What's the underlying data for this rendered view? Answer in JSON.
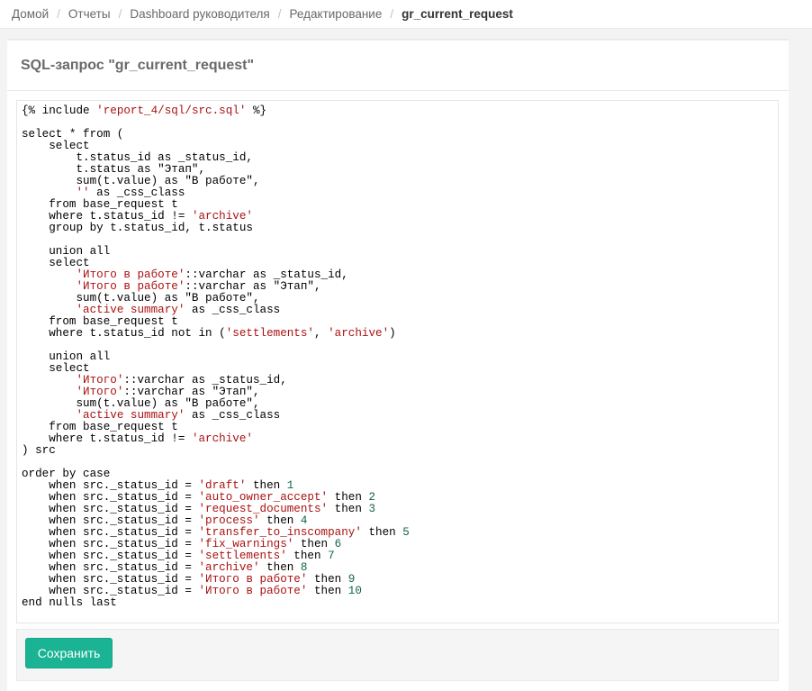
{
  "breadcrumb": {
    "items": [
      "Домой",
      "Отчеты",
      "Dashboard руководителя",
      "Редактирование"
    ],
    "current": "gr_current_request",
    "separator": "/"
  },
  "panel": {
    "title": "SQL-запрос \"gr_current_request\""
  },
  "editor": {
    "lines": [
      "{% include 'report_4/sql/src.sql' %}",
      "",
      "select * from (",
      "    select",
      "        t.status_id as _status_id,",
      "        t.status as \"Этап\",",
      "        sum(t.value) as \"В работе\",",
      "        '' as _css_class",
      "    from base_request t",
      "    where t.status_id != 'archive'",
      "    group by t.status_id, t.status",
      "",
      "    union all",
      "    select",
      "        'Итого в работе'::varchar as _status_id,",
      "        'Итого в работе'::varchar as \"Этап\",",
      "        sum(t.value) as \"В работе\",",
      "        'active summary' as _css_class",
      "    from base_request t",
      "    where t.status_id not in ('settlements', 'archive')",
      "",
      "    union all",
      "    select",
      "        'Итого'::varchar as _status_id,",
      "        'Итого'::varchar as \"Этап\",",
      "        sum(t.value) as \"В работе\",",
      "        'active summary' as _css_class",
      "    from base_request t",
      "    where t.status_id != 'archive'",
      ") src",
      "",
      "order by case",
      "    when src._status_id = 'draft' then 1",
      "    when src._status_id = 'auto_owner_accept' then 2",
      "    when src._status_id = 'request_documents' then 3",
      "    when src._status_id = 'process' then 4",
      "    when src._status_id = 'transfer_to_inscompany' then 5",
      "    when src._status_id = 'fix_warnings' then 6",
      "    when src._status_id = 'settlements' then 7",
      "    when src._status_id = 'archive' then 8",
      "    when src._status_id = 'Итого в работе' then 9",
      "    when src._status_id = 'Итого в работе' then 10",
      "end nulls last"
    ]
  },
  "actions": {
    "save_label": "Сохранить"
  },
  "colors": {
    "accent": "#1ab394",
    "string": "#aa1111",
    "number": "#116644"
  }
}
